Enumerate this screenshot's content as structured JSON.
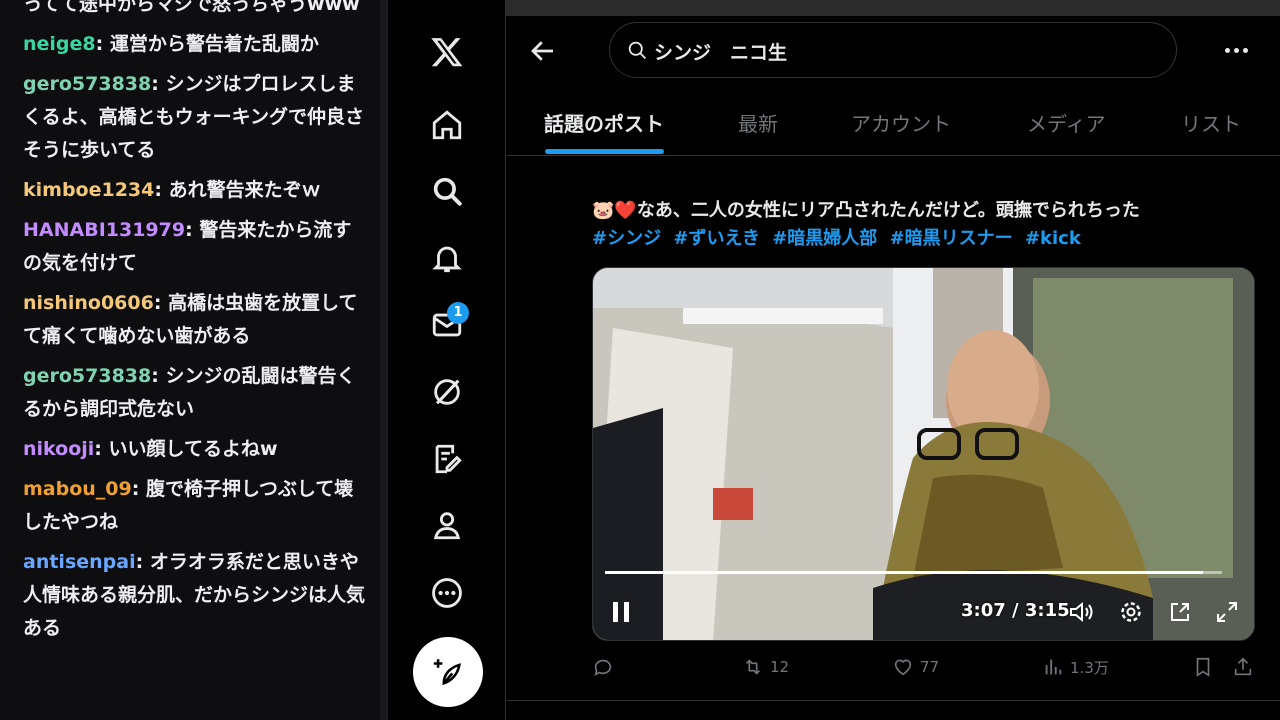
{
  "chat": {
    "messages": [
      {
        "user": "",
        "color": "#efeff1",
        "text": "ってて途中からマジで怒っちゃうwww"
      },
      {
        "user": "neige8",
        "color": "#3ad6a2",
        "text": "運営から警告着た乱闘か"
      },
      {
        "user": "gero573838",
        "color": "#7fd3b0",
        "text": "シンジはプロレスしまくるよ、高橋ともウォーキングで仲良さそうに歩いてる"
      },
      {
        "user": "kimboe1234",
        "color": "#f4c87a",
        "text": "あれ警告来たぞｗ"
      },
      {
        "user": "HANABI131979",
        "color": "#c28bff",
        "text": "警告来たから流すの気を付けて"
      },
      {
        "user": "nishino0606",
        "color": "#f4c87a",
        "text": "高橋は虫歯を放置してて痛くて噛めない歯がある"
      },
      {
        "user": "gero573838",
        "color": "#7fd3b0",
        "text": "シンジの乱闘は警告くるから調印式危ない"
      },
      {
        "user": "nikooji",
        "color": "#c28bff",
        "text": "いい顔してるよねw"
      },
      {
        "user": "mabou_09",
        "color": "#f0a030",
        "text": "腹で椅子押しつぶして壊したやつね"
      },
      {
        "user": "antisenpai",
        "color": "#6aa6ff",
        "text": "オラオラ系だと思いきや人情味ある親分肌、だからシンジは人気ある"
      }
    ]
  },
  "nav": {
    "items": [
      {
        "name": "x-logo-icon",
        "label": "X"
      },
      {
        "name": "home-icon",
        "label": "Home"
      },
      {
        "name": "search-icon",
        "label": "Explore"
      },
      {
        "name": "bell-icon",
        "label": "Notifications"
      },
      {
        "name": "mail-icon",
        "label": "Messages"
      },
      {
        "name": "grok-icon",
        "label": "Grok"
      },
      {
        "name": "edit-note-icon",
        "label": "Drafts"
      },
      {
        "name": "profile-icon",
        "label": "Profile"
      },
      {
        "name": "more-icon",
        "label": "More"
      },
      {
        "name": "compose-icon",
        "label": "Post"
      }
    ],
    "messages_badge": "1"
  },
  "search": {
    "query": "シンジ　ニコ生"
  },
  "tabs": [
    {
      "label": "話題のポスト",
      "active": true
    },
    {
      "label": "最新",
      "active": false
    },
    {
      "label": "アカウント",
      "active": false
    },
    {
      "label": "メディア",
      "active": false
    },
    {
      "label": "リスト",
      "active": false
    }
  ],
  "tweet": {
    "text": "🐷❤️なあ、二人の女性にリア凸されたんだけど。頭撫でられちった",
    "hashtags": [
      "#シンジ",
      "#ずいえき",
      "#暗黒婦人部",
      "#暗黒リスナー",
      "#kick"
    ],
    "video": {
      "time": "3:07 / 3:15",
      "progress": 0.97
    },
    "actions": {
      "replies": "",
      "reposts": "12",
      "likes": "77",
      "views": "1.3万"
    }
  },
  "colors": {
    "accent": "#1d9bf0",
    "bg": "#000000",
    "muted": "#71767b"
  }
}
